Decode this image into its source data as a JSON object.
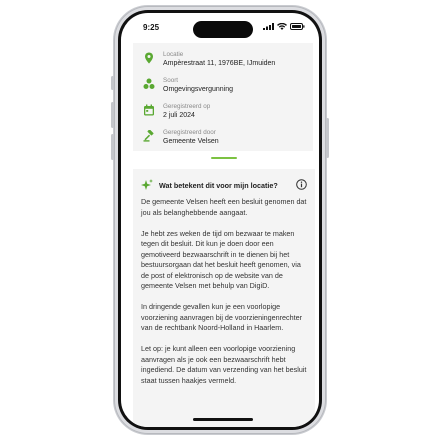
{
  "status_bar": {
    "time": "9:25"
  },
  "info": {
    "location": {
      "label": "Locatie",
      "value": "Ampèrestraat 11, 1976BE, IJmuiden"
    },
    "type": {
      "label": "Soort",
      "value": "Omgevingsvergunning"
    },
    "registered_on": {
      "label": "Geregistreerd op",
      "value": "2 juli 2024"
    },
    "registered_by": {
      "label": "Geregistreerd door",
      "value": "Gemeente Velsen"
    }
  },
  "explanation": {
    "title": "Wat betekent dit voor mijn locatie?",
    "paragraphs": [
      "De gemeente Velsen heeft een besluit genomen dat jou als belanghebbende aangaat.",
      "Je hebt zes weken de tijd om bezwaar te maken tegen dit besluit. Dit kun je doen door een gemotiveerd bezwaarschrift in te dienen bij het bestuursorgaan dat het besluit heeft genomen, via de post of elektronisch op de website van de gemeente Velsen met behulp van DigiD.",
      "In dringende gevallen kun je een voorlopige voorziening aanvragen bij de voorzieningenrechter van de rechtbank Noord-Holland in Haarlem.",
      "Let op: je kunt alleen een voorlopige voorziening aanvragen als je ook een bezwaarschrift hebt ingediend. De datum van verzending van het besluit staat tussen haakjes vermeld."
    ]
  },
  "colors": {
    "accent": "#7cc242",
    "card_bg": "#f4f4f4"
  },
  "icons": [
    "location-pin-icon",
    "category-icon",
    "calendar-icon",
    "gavel-icon",
    "sparkle-icon",
    "info-icon"
  ]
}
